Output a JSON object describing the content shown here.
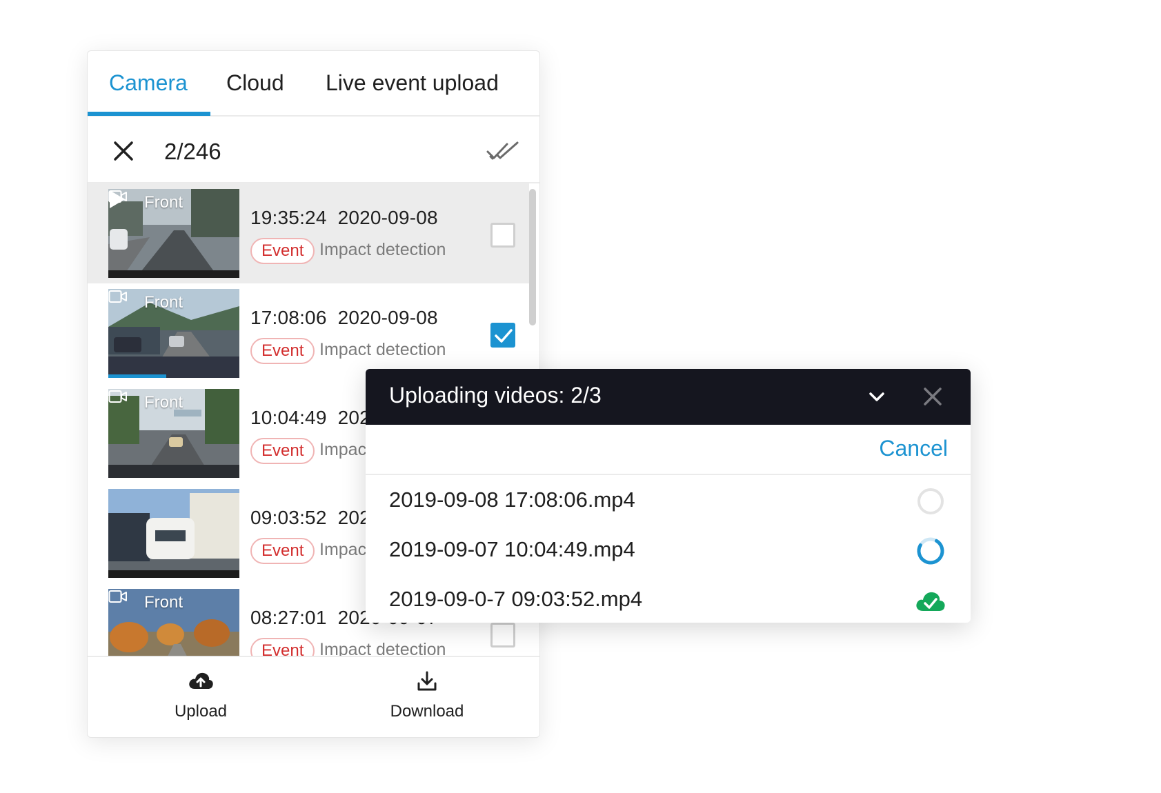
{
  "tabs": [
    {
      "label": "Camera",
      "active": true
    },
    {
      "label": "Cloud",
      "active": false
    },
    {
      "label": "Live event upload",
      "active": false
    }
  ],
  "selection": {
    "count": "2/246"
  },
  "recordings": [
    {
      "camera": "Front",
      "time": "19:35:24",
      "date": "2020-09-08",
      "badge": "Event",
      "type": "Impact detection",
      "checked": false,
      "highlighted": true
    },
    {
      "camera": "Front",
      "time": "17:08:06",
      "date": "2020-09-08",
      "badge": "Event",
      "type": "Impact detection",
      "checked": true,
      "highlighted": false
    },
    {
      "camera": "Front",
      "time": "10:04:49",
      "date": "202",
      "badge": "Event",
      "type": "Impact",
      "checked": false,
      "highlighted": false
    },
    {
      "camera": "",
      "time": "09:03:52",
      "date": "202",
      "badge": "Event",
      "type": "Impact",
      "checked": false,
      "highlighted": false
    },
    {
      "camera": "Front",
      "time": "08:27:01",
      "date": "2020-09-07",
      "badge": "Event",
      "type": "Impact detection",
      "checked": false,
      "highlighted": false
    }
  ],
  "bottom_bar": {
    "upload_label": "Upload",
    "download_label": "Download"
  },
  "upload_popup": {
    "title": "Uploading videos: 2/3",
    "cancel_label": "Cancel",
    "items": [
      {
        "filename": "2019-09-08 17:08:06.mp4",
        "status": "pending"
      },
      {
        "filename": "2019-09-07 10:04:49.mp4",
        "status": "uploading"
      },
      {
        "filename": "2019-09-0-7 09:03:52.mp4",
        "status": "done"
      }
    ]
  },
  "colors": {
    "accent": "#1c93d1",
    "event_red": "#d32f2f",
    "success_green": "#14a85a",
    "popup_header": "#15161f"
  },
  "icons": {
    "close": "close-icon",
    "select_all": "double-check-icon",
    "camera": "video-camera-icon",
    "play": "play-icon",
    "upload": "cloud-upload-icon",
    "download": "download-icon",
    "collapse": "chevron-down-icon",
    "done": "cloud-check-icon"
  }
}
